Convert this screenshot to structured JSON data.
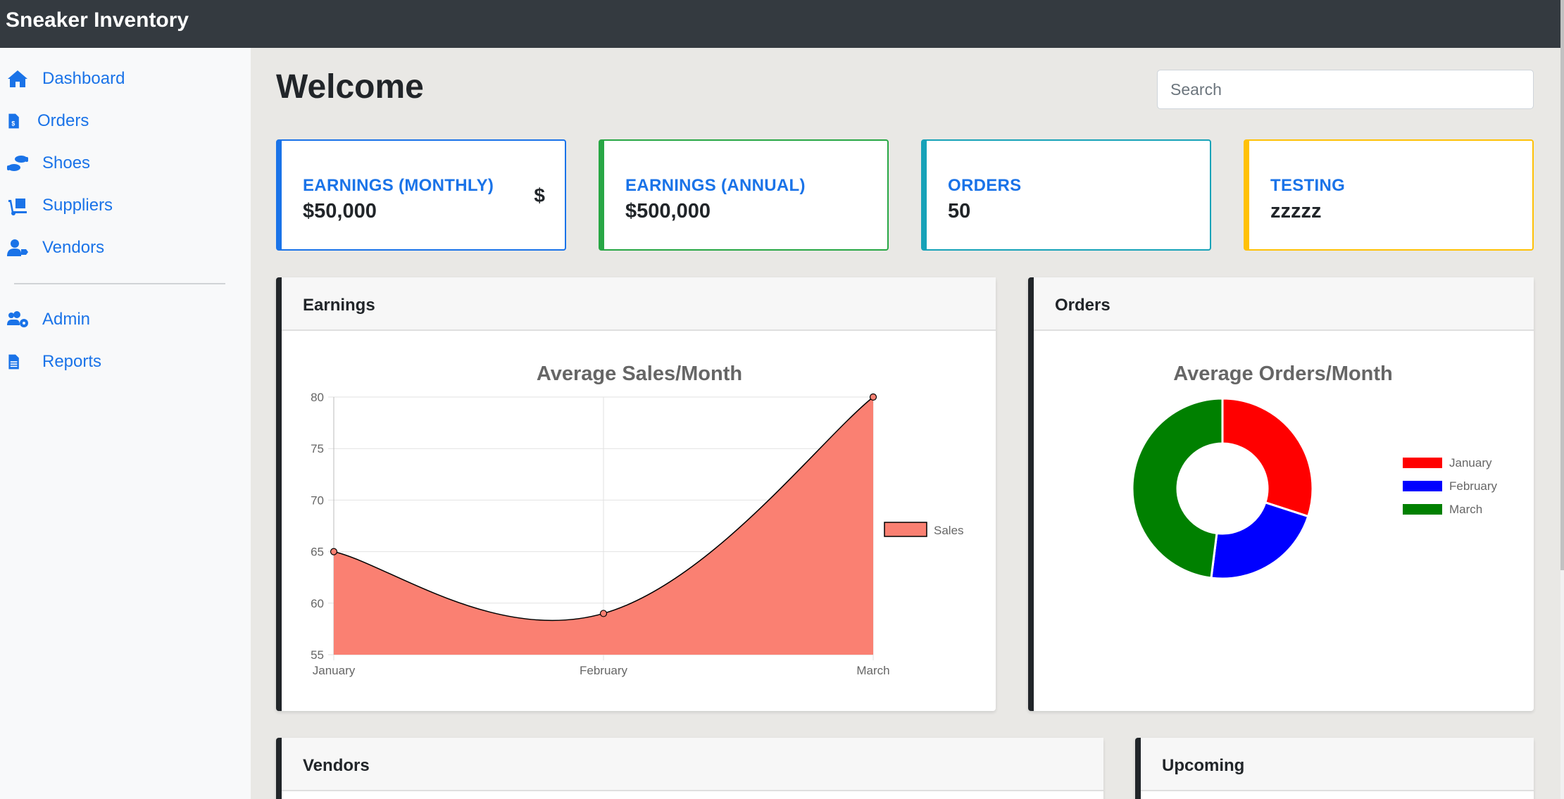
{
  "app": {
    "title": "Sneaker Inventory"
  },
  "sidebar": {
    "items": [
      {
        "label": "Dashboard",
        "icon": "home-icon"
      },
      {
        "label": "Orders",
        "icon": "invoice-icon"
      },
      {
        "label": "Shoes",
        "icon": "shoe-prints-icon"
      },
      {
        "label": "Suppliers",
        "icon": "dolly-icon"
      },
      {
        "label": "Vendors",
        "icon": "user-tag-icon"
      },
      {
        "label": "Admin",
        "icon": "users-cog-icon"
      },
      {
        "label": "Reports",
        "icon": "file-icon"
      }
    ]
  },
  "header": {
    "title": "Welcome"
  },
  "search": {
    "placeholder": "Search"
  },
  "cards": [
    {
      "title": "EARNINGS (MONTHLY)",
      "value": "$50,000",
      "icon": "$",
      "border_color": "#1a73e8"
    },
    {
      "title": "EARNINGS (ANNUAL)",
      "value": "$500,000",
      "border_color": "#28a745"
    },
    {
      "title": "ORDERS",
      "value": "50",
      "border_color": "#17a2b8"
    },
    {
      "title": "TESTING",
      "value": "zzzzz",
      "border_color": "#ffc107"
    }
  ],
  "panels": {
    "earnings": "Earnings",
    "orders": "Orders",
    "vendors": "Vendors",
    "upcoming": "Upcoming"
  },
  "chart_data": [
    {
      "type": "area",
      "title": "Average Sales/Month",
      "categories": [
        "January",
        "February",
        "March"
      ],
      "series": [
        {
          "name": "Sales",
          "values": [
            65,
            59,
            80
          ],
          "color": "#fa8072"
        }
      ],
      "ylim": [
        55,
        80
      ],
      "yticks": [
        80,
        75,
        70,
        65,
        60,
        55
      ],
      "legend": "right",
      "grid": true
    },
    {
      "type": "pie",
      "title": "Average Orders/Month",
      "labels": [
        "January",
        "February",
        "March"
      ],
      "values": [
        30,
        22,
        48
      ],
      "colors": [
        "#ff0000",
        "#0000ff",
        "#008000"
      ],
      "legend": "right"
    }
  ]
}
